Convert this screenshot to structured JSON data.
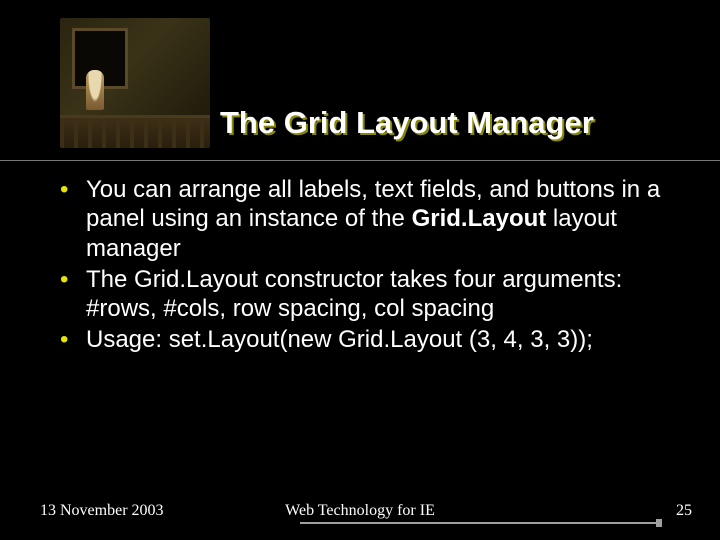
{
  "title": "The Grid Layout Manager",
  "bullets": [
    {
      "pre": "You can arrange all labels, text fields, and buttons in a panel using an instance of the ",
      "bold": "Grid.Layout",
      "post": " layout manager"
    },
    {
      "pre": "The Grid.Layout constructor takes four arguments: #rows, #cols, row spacing, col spacing",
      "bold": "",
      "post": ""
    },
    {
      "pre": "Usage: set.Layout(new Grid.Layout (3, 4, 3, 3));",
      "bold": "",
      "post": ""
    }
  ],
  "footer": {
    "date": "13 November 2003",
    "center": "Web Technology for IE",
    "page": "25"
  }
}
